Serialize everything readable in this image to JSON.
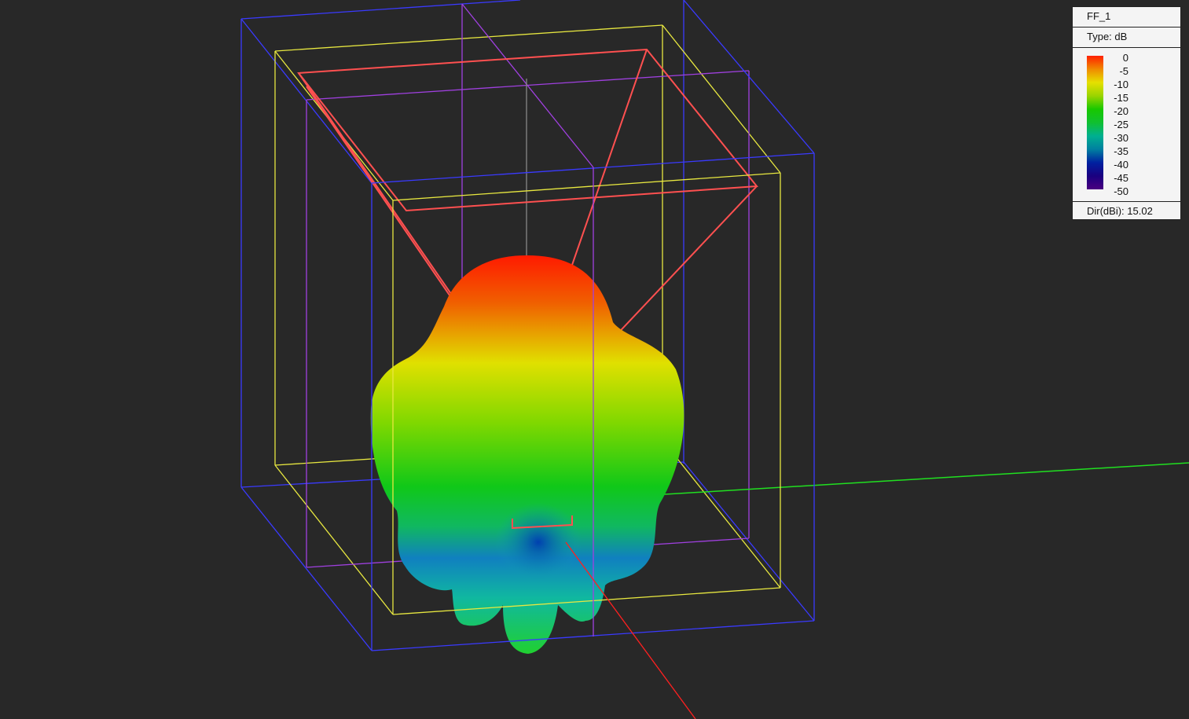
{
  "legend": {
    "title": "FF_1",
    "type_label": "Type: dB",
    "ticks": [
      "0",
      "-5",
      "-10",
      "-15",
      "-20",
      "-25",
      "-30",
      "-35",
      "-40",
      "-45",
      "-50"
    ],
    "directivity": "Dir(dBi): 15.02"
  },
  "colors": {
    "background": "#282828",
    "outer_box": "#3a3aff",
    "inner_box": "#e8e840",
    "mid_box": "#a040e0",
    "horn": "#ff5050",
    "x_axis": "#ff2020",
    "y_axis": "#20e020"
  }
}
